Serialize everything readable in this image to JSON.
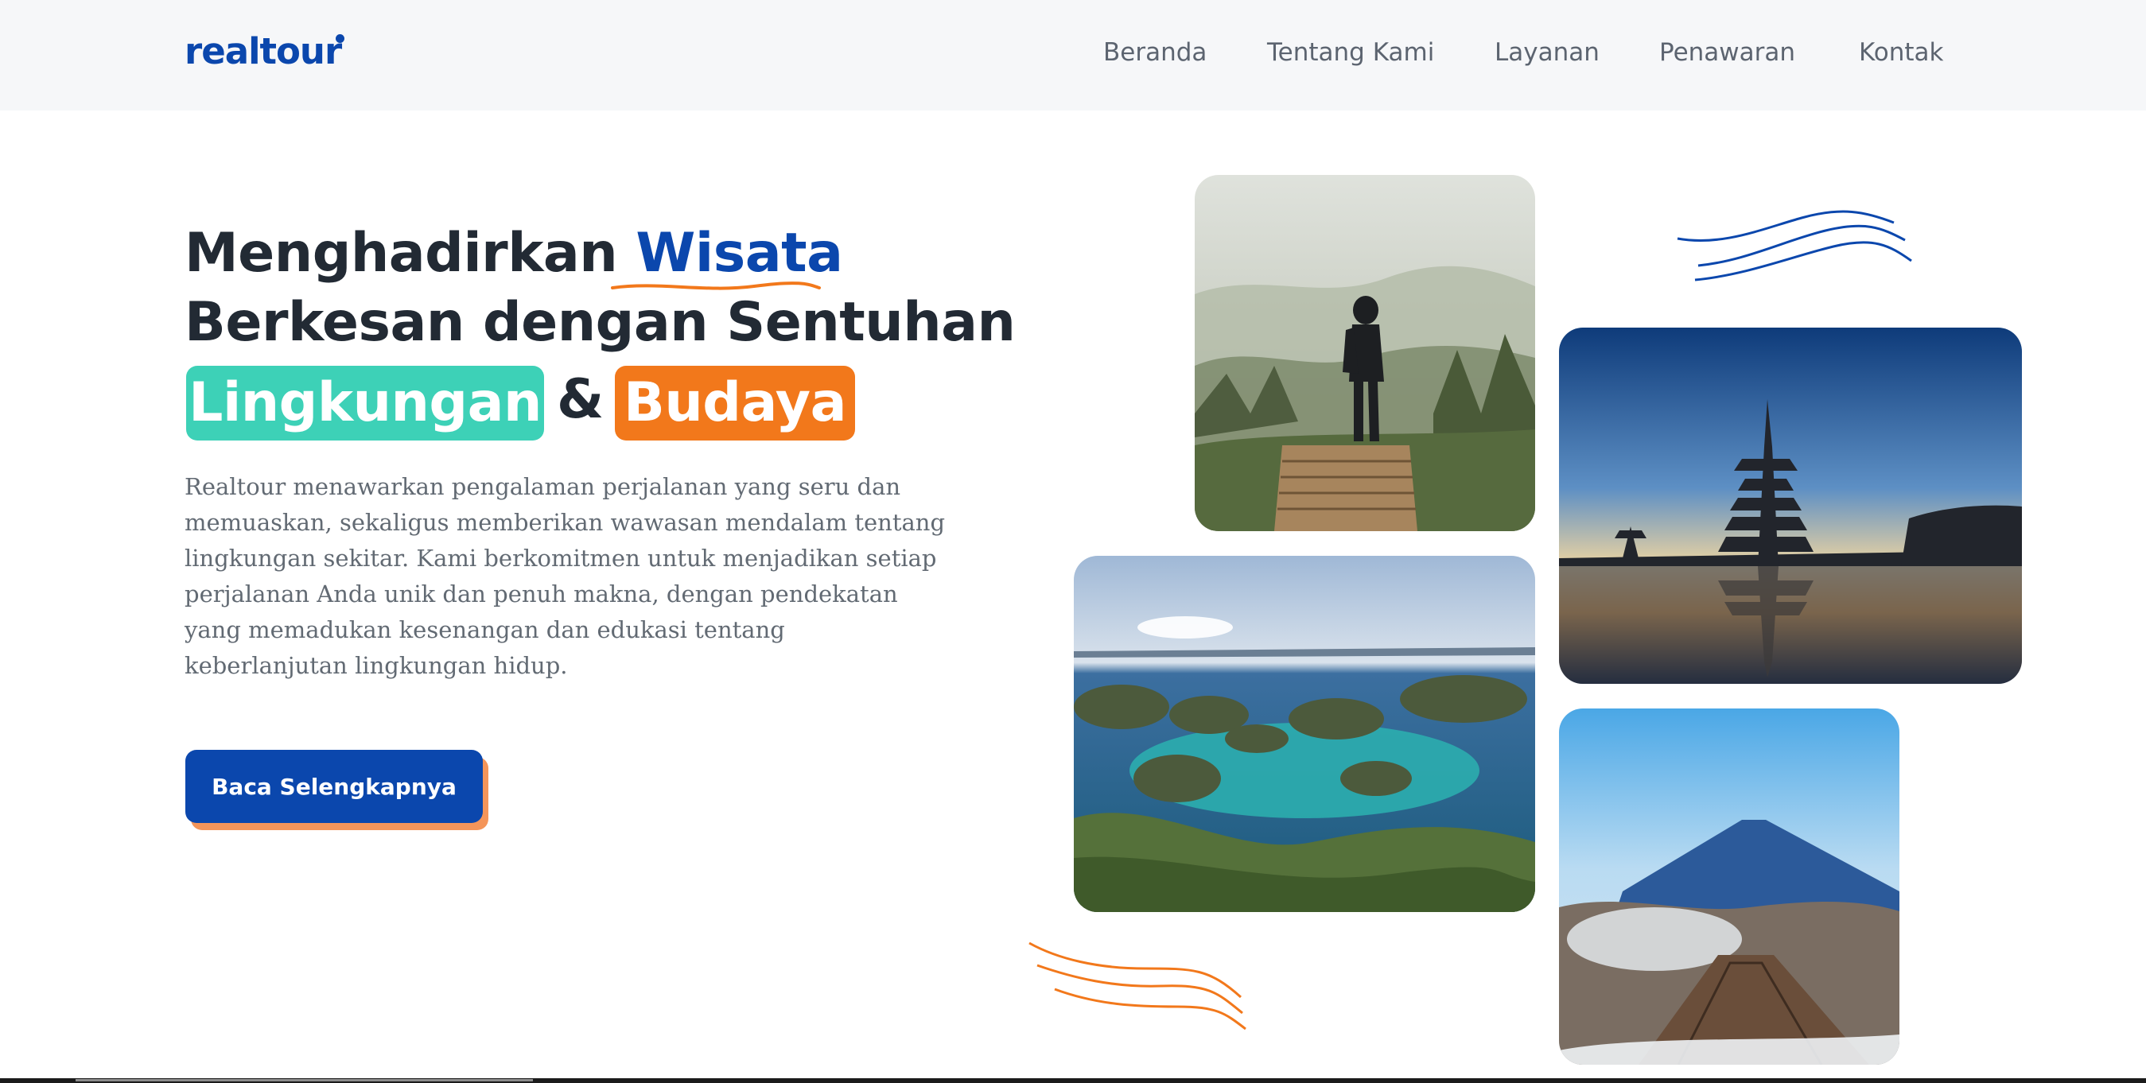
{
  "brand": {
    "name": "realtour",
    "color": "#0b47ad"
  },
  "nav": {
    "items": [
      {
        "label": "Beranda"
      },
      {
        "label": "Tentang Kami"
      },
      {
        "label": "Layanan"
      },
      {
        "label": "Penawaran"
      },
      {
        "label": "Kontak"
      }
    ]
  },
  "hero": {
    "line1_prefix": "Menghadirkan",
    "line1_accent": "Wisata",
    "line2": "Berkesan dengan Sentuhan",
    "pill_left": "Lingkungan",
    "ampersand": "&",
    "pill_right": "Budaya",
    "description": "Realtour menawarkan pengalaman perjalanan yang seru dan memuaskan, sekaligus memberikan wawasan mendalam tentang lingkungan sekitar. Kami berkomitmen untuk menjadikan setiap perjalanan Anda unik dan penuh makna, dengan pendekatan yang memadukan kesenangan dan edukasi tentang keberlanjutan lingkungan hidup.",
    "description_lines": [
      "Realtour menawarkan pengalaman perjalanan yang seru dan",
      "memuaskan, sekaligus memberikan wawasan mendalam tentang",
      "lingkungan sekitar. Kami berkomitmen untuk menjadikan setiap",
      "perjalanan Anda unik dan penuh makna, dengan pendekatan",
      "yang memadukan kesenangan dan edukasi tentang",
      "keberlanjutan lingkungan hidup."
    ],
    "cta_label": "Baca Selengkapnya"
  },
  "colors": {
    "primary": "#0b47ad",
    "green": "#3dd1b7",
    "orange": "#f2781b",
    "text_dark": "#222a34",
    "text_muted": "#626a73"
  },
  "gallery": {
    "photos": [
      {
        "subject": "hiker-misty-forest"
      },
      {
        "subject": "bali-temple-lake"
      },
      {
        "subject": "raja-ampat-islands"
      },
      {
        "subject": "bromo-volcano"
      }
    ]
  }
}
